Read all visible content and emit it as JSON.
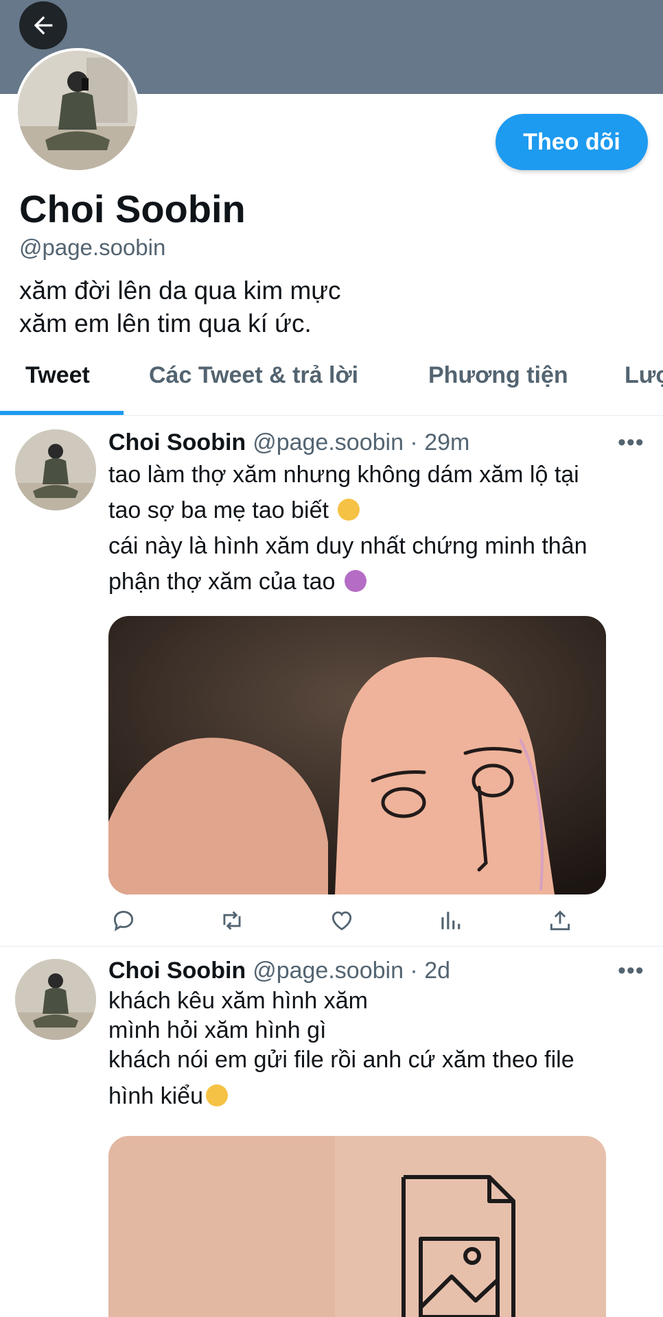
{
  "colors": {
    "accent": "#1d9bf0",
    "banner": "#66788a",
    "secondary_text": "#536471"
  },
  "header": {
    "back_icon": "arrow-left-icon"
  },
  "profile": {
    "name": "Choi Soobin",
    "handle": "@page.soobin",
    "bio": "xăm đời lên da qua kim mực\nxăm em lên tim qua kí ức.",
    "follow_label": "Theo dõi"
  },
  "tabs": [
    "Tweet",
    "Các Tweet & trả lời",
    "Phương tiện",
    "Lượt thích"
  ],
  "active_tab": "Tweet",
  "tweets": [
    {
      "name": "Choi Soobin",
      "meta": "@page.soobin · 29m",
      "more": "•••",
      "lines": [
        "tao làm thợ xăm nhưng không dám xăm lộ tại",
        "tao sợ ba mẹ tao biết",
        "cái này là hình xăm duy nhất chứng minh thân",
        "phận thợ xăm của tao"
      ],
      "emojis": [
        "loudly-crying-face-emoji",
        "person-tipping-hand-emoji"
      ],
      "media": "thumb-tattoo-face-photo",
      "actions": [
        "reply-icon",
        "retweet-icon",
        "like-icon",
        "analytics-icon",
        "share-icon"
      ]
    },
    {
      "name": "Choi Soobin",
      "meta": "@page.soobin · 2d",
      "more": "•••",
      "lines": [
        "khách kêu xăm hình xăm",
        "mình hỏi xăm hình gì",
        "khách nói em gửi file rồi anh cứ xăm theo file",
        "hình kiểu"
      ],
      "emojis": [
        "slightly-smiling-face-emoji"
      ],
      "media": "file-icon-tattoo-photo"
    }
  ]
}
